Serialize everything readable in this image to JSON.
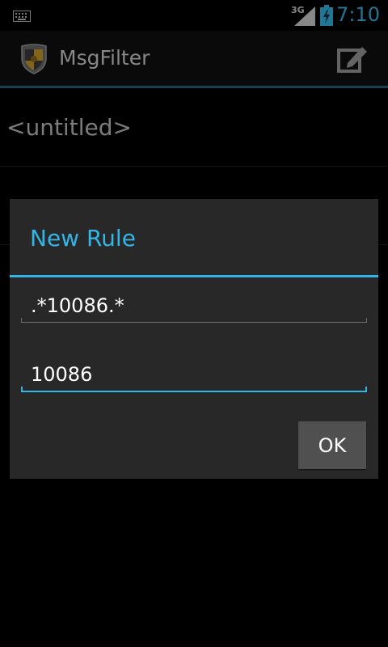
{
  "status_bar": {
    "network_type": "3G",
    "time": "7:10",
    "icons": [
      "keyboard-icon",
      "signal-icon",
      "battery-charging-icon"
    ],
    "accent_color": "#33b5e5"
  },
  "action_bar": {
    "app_title": "MsgFilter",
    "app_icon": "shield-crest-icon",
    "compose_icon": "compose-icon"
  },
  "list": {
    "items": [
      {
        "label": "<untitled>"
      },
      {
        "label": ""
      }
    ]
  },
  "dialog": {
    "title": "New Rule",
    "pattern_value": ".*10086.*",
    "number_value": "10086",
    "ok_label": "OK"
  }
}
